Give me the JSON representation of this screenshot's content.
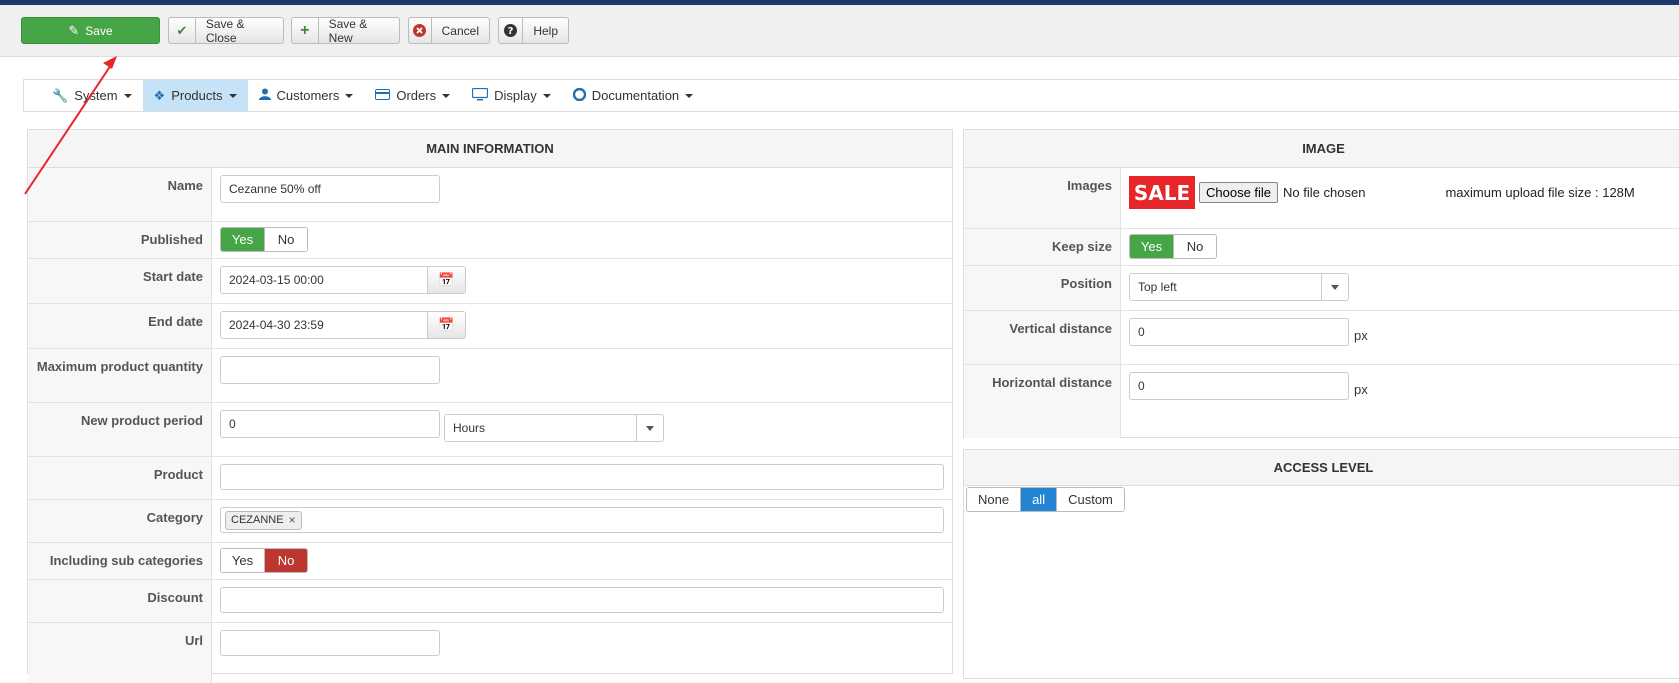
{
  "toolbar": {
    "save": "Save",
    "save_close": "Save & Close",
    "save_new": "Save & New",
    "cancel": "Cancel",
    "help": "Help"
  },
  "nav": {
    "system": "System",
    "products": "Products",
    "customers": "Customers",
    "orders": "Orders",
    "display": "Display",
    "documentation": "Documentation",
    "active": "Products"
  },
  "main": {
    "title": "MAIN INFORMATION",
    "name": {
      "label": "Name",
      "value": "Cezanne 50% off"
    },
    "published": {
      "label": "Published",
      "yes": "Yes",
      "no": "No",
      "selected": "Yes"
    },
    "start_date": {
      "label": "Start date",
      "value": "2024-03-15 00:00"
    },
    "end_date": {
      "label": "End date",
      "value": "2024-04-30 23:59"
    },
    "max_qty": {
      "label": "Maximum product quantity",
      "value": ""
    },
    "new_period": {
      "label": "New product period",
      "value": "0",
      "unit": "Hours"
    },
    "product": {
      "label": "Product",
      "value": ""
    },
    "category": {
      "label": "Category",
      "tag": "CEZANNE"
    },
    "sub_categories": {
      "label": "Including sub categories",
      "yes": "Yes",
      "no": "No",
      "selected": "No"
    },
    "discount": {
      "label": "Discount",
      "value": ""
    },
    "url": {
      "label": "Url",
      "value": ""
    }
  },
  "image": {
    "title": "IMAGE",
    "images": {
      "label": "Images",
      "badge": "SALE",
      "choose": "Choose file",
      "no_file": "No file chosen",
      "max_size": "maximum upload file size : 128M"
    },
    "keep_size": {
      "label": "Keep size",
      "yes": "Yes",
      "no": "No",
      "selected": "Yes"
    },
    "position": {
      "label": "Position",
      "value": "Top left"
    },
    "vertical": {
      "label": "Vertical distance",
      "value": "0",
      "unit": "px"
    },
    "horizontal": {
      "label": "Horizontal distance",
      "value": "0",
      "unit": "px"
    }
  },
  "access": {
    "title": "ACCESS LEVEL",
    "options": [
      "None",
      "all",
      "Custom"
    ],
    "selected": "all"
  },
  "colors": {
    "accent_green": "#46a546",
    "accent_red": "#bd362f",
    "accent_blue": "#2384d3",
    "nav_active": "#c5e2f6",
    "annotation_arrow": "#e8252a"
  },
  "icons": {
    "save": "edit-icon",
    "save_close": "check-icon",
    "save_new": "plus-icon",
    "cancel": "cancel-circle-icon",
    "help": "question-circle-icon",
    "system": "wrench-icon",
    "products": "cubes-icon",
    "customers": "user-icon",
    "orders": "credit-card-icon",
    "display": "monitor-icon",
    "documentation": "lifebuoy-icon",
    "calendar": "calendar-icon"
  }
}
